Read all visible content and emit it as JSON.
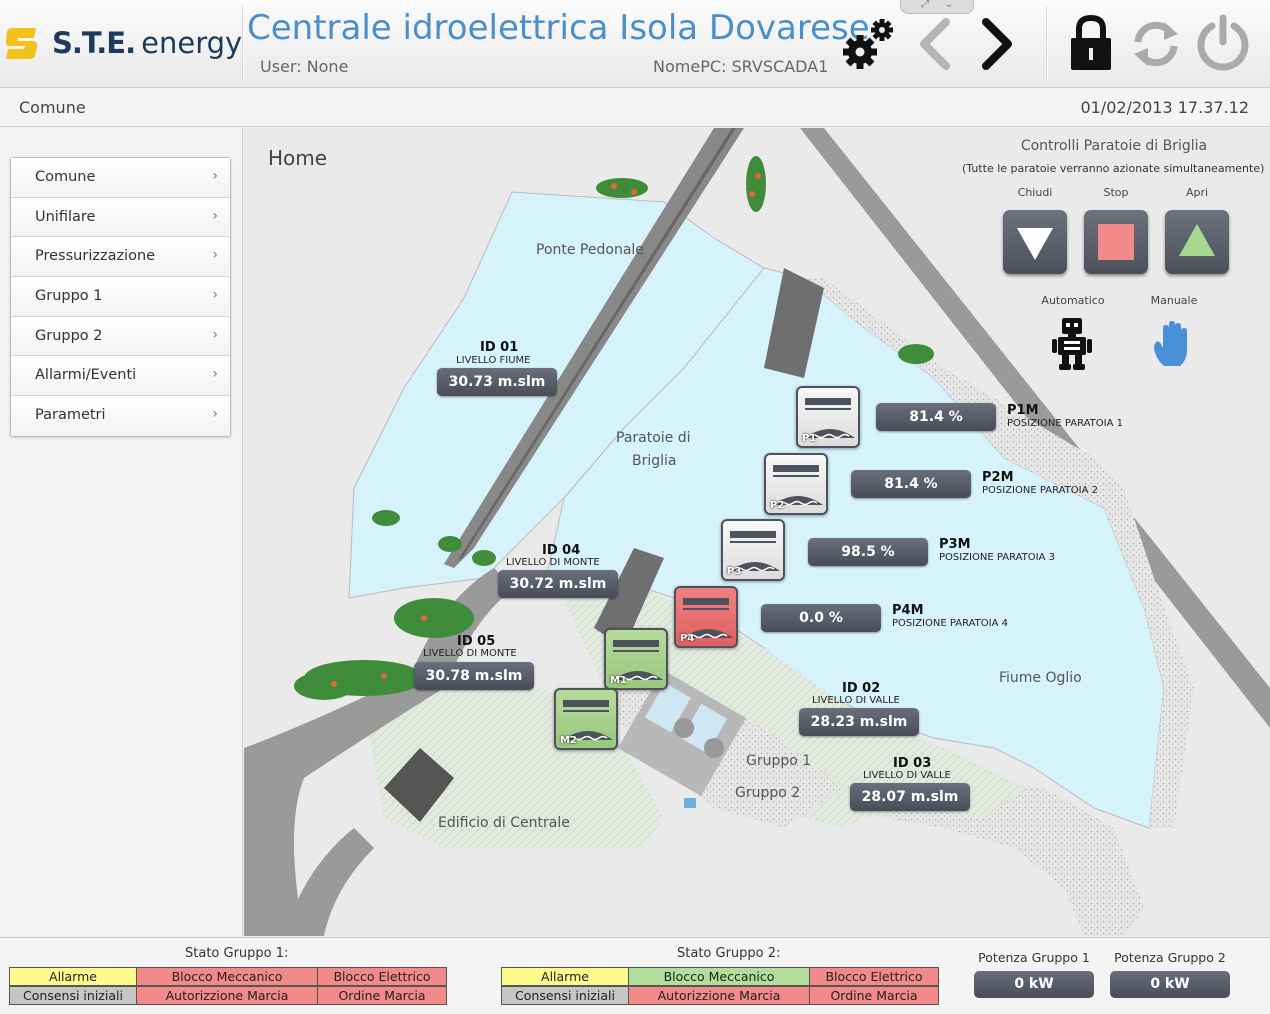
{
  "header": {
    "brand_bold": "S.T.E.",
    "brand_light": "energy",
    "title": "Centrale idroelettrica Isola Dovarese",
    "user": "User: None",
    "pc_name": "NomePC: SRVSCADA1",
    "icons": [
      "gears-icon",
      "back-icon",
      "forward-icon",
      "lock-icon",
      "refresh-icon",
      "power-icon"
    ],
    "colors": {
      "title": "#4a8fc9",
      "logo": "#f2c21b"
    }
  },
  "subbar": {
    "page": "Comune",
    "datetime": "01/02/2013 17.37.12"
  },
  "sidebar": {
    "items": [
      {
        "label": "Comune"
      },
      {
        "label": "Unifilare"
      },
      {
        "label": "Pressurizzazione"
      },
      {
        "label": "Gruppo 1"
      },
      {
        "label": "Gruppo 2"
      },
      {
        "label": "Allarmi/Eventi"
      },
      {
        "label": "Parametri"
      }
    ]
  },
  "map": {
    "title": "Home",
    "labels": {
      "ponte": "Ponte Pedonale",
      "paratoie_1": "Paratoie di",
      "paratoie_2": "Briglia",
      "fiume": "Fiume Oglio",
      "gruppo1": "Gruppo 1",
      "gruppo2": "Gruppo 2",
      "edificio": "Edificio di Centrale"
    },
    "sensors": [
      {
        "id": "ID 01",
        "desc": "LIVELLO FIUME",
        "value": "30.73  m.slm"
      },
      {
        "id": "ID 04",
        "desc": "LIVELLO DI MONTE",
        "value": "30.72  m.slm"
      },
      {
        "id": "ID 05",
        "desc": "LIVELLO DI MONTE",
        "value": "30.78  m.slm"
      },
      {
        "id": "ID 02",
        "desc": "LIVELLO DI VALLE",
        "value": "28.23  m.slm"
      },
      {
        "id": "ID 03",
        "desc": "LIVELLO DI VALLE",
        "value": "28.07  m.slm"
      }
    ],
    "gates": [
      {
        "label": "P1",
        "state": "white",
        "value": "81.4  %",
        "code": "P1M",
        "desc": "POSIZIONE PARATOIA 1"
      },
      {
        "label": "P2",
        "state": "white",
        "value": "81.4  %",
        "code": "P2M",
        "desc": "POSIZIONE PARATOIA 2"
      },
      {
        "label": "P3",
        "state": "white",
        "value": "98.5  %",
        "code": "P3M",
        "desc": "POSIZIONE PARATOIA 3"
      },
      {
        "label": "P4",
        "state": "red",
        "value": "0.0  %",
        "code": "P4M",
        "desc": "POSIZIONE PARATOIA 4"
      }
    ],
    "intakes": [
      {
        "label": "M1",
        "state": "green"
      },
      {
        "label": "M2",
        "state": "green"
      }
    ]
  },
  "controls": {
    "title": "Controlli Paratoie di Briglia",
    "subtitle": "(Tutte le paratoie verranno azionate simultaneamente)",
    "close_label": "Chiudi",
    "stop_label": "Stop",
    "open_label": "Apri",
    "auto_label": "Automatico",
    "manual_label": "Manuale",
    "colors": {
      "close": "#ffffff",
      "stop": "#f28a8a",
      "open": "#a8d890",
      "manual": "#4a90d9"
    }
  },
  "footer": {
    "group1": {
      "title": "Stato Gruppo 1:",
      "cells": [
        {
          "label": "Allarme",
          "state": "yellow"
        },
        {
          "label": "Blocco Meccanico",
          "state": "red"
        },
        {
          "label": "Blocco Elettrico",
          "state": "red"
        },
        {
          "label": "Consensi iniziali",
          "state": "gray"
        },
        {
          "label": "Autorizzione Marcia",
          "state": "red"
        },
        {
          "label": "Ordine Marcia",
          "state": "red"
        }
      ]
    },
    "group2": {
      "title": "Stato Gruppo 2:",
      "cells": [
        {
          "label": "Allarme",
          "state": "yellow"
        },
        {
          "label": "Blocco Meccanico",
          "state": "green"
        },
        {
          "label": "Blocco Elettrico",
          "state": "red"
        },
        {
          "label": "Consensi iniziali",
          "state": "gray"
        },
        {
          "label": "Autorizzione Marcia",
          "state": "red"
        },
        {
          "label": "Ordine Marcia",
          "state": "red"
        }
      ]
    },
    "power1": {
      "title": "Potenza Gruppo 1",
      "value": "0  kW"
    },
    "power2": {
      "title": "Potenza Gruppo 2",
      "value": "0  kW"
    }
  }
}
